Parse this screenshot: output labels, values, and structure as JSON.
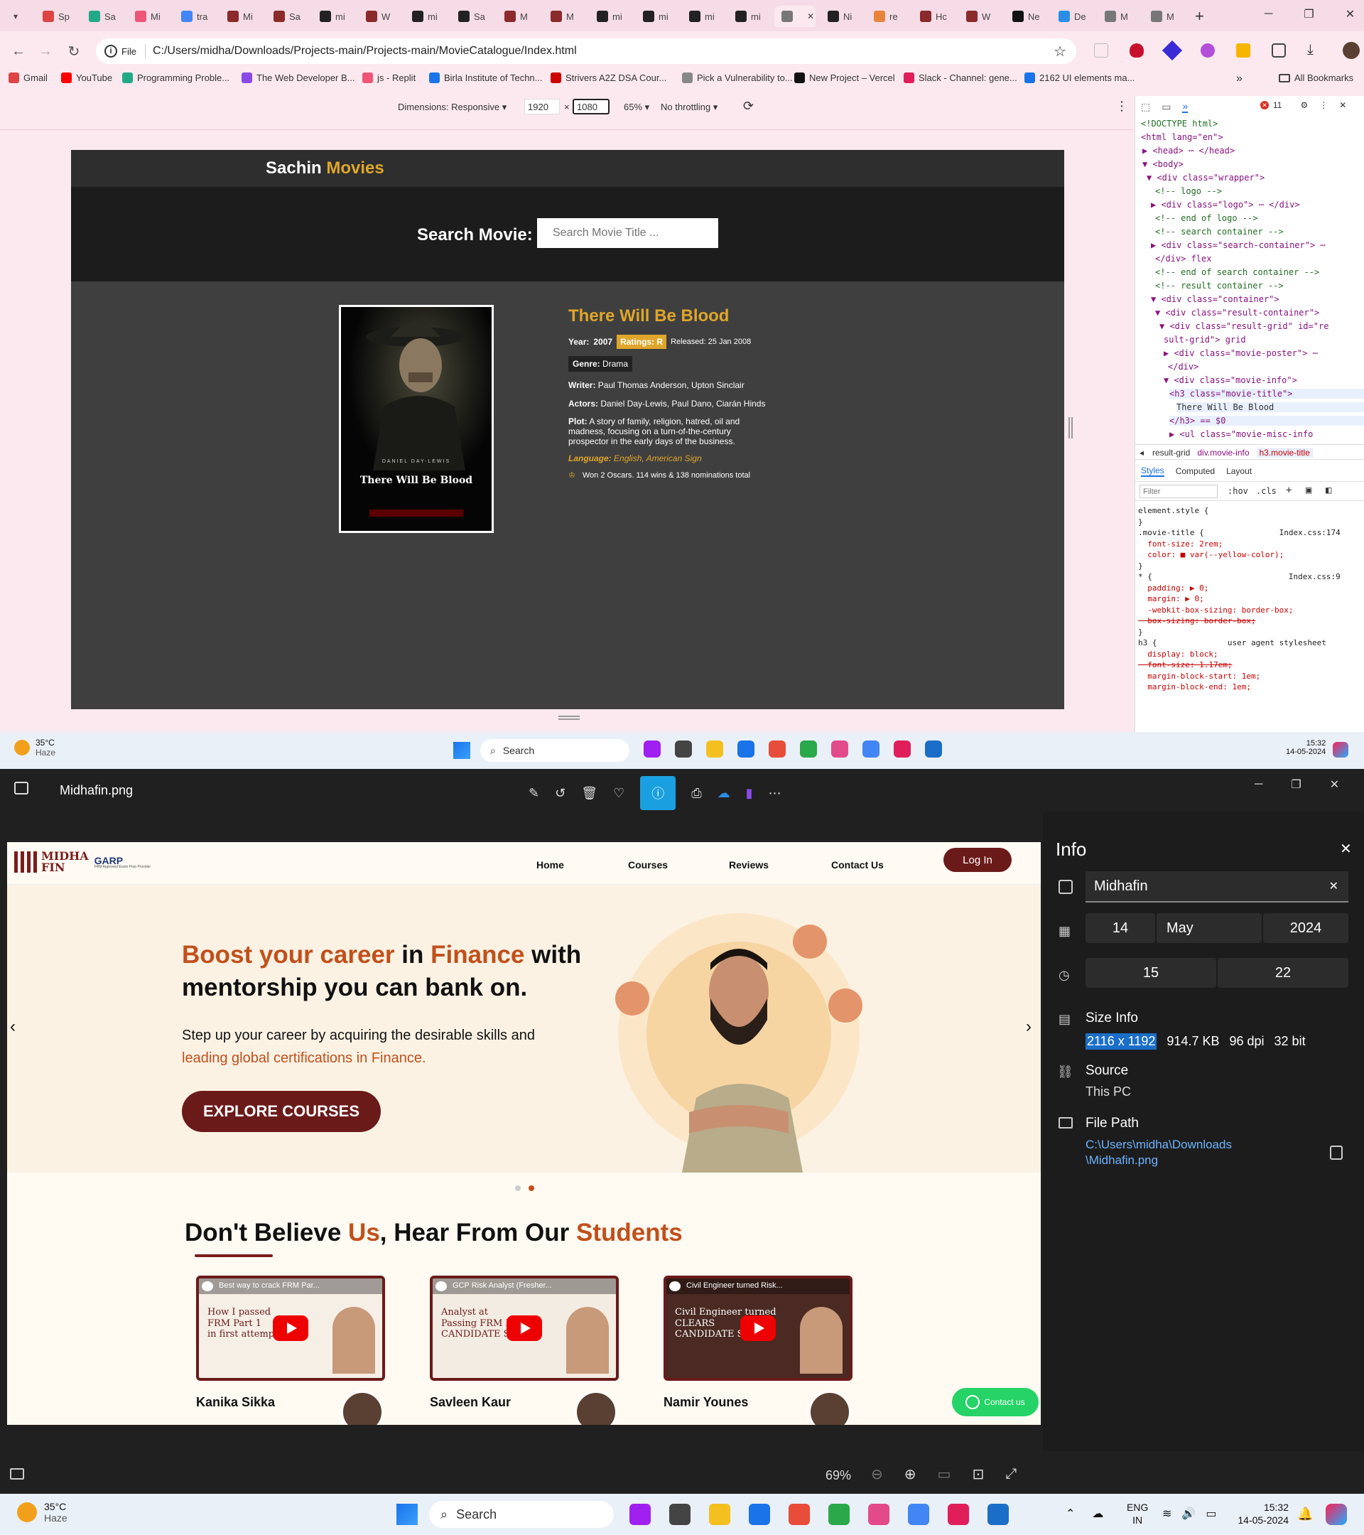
{
  "browser": {
    "tabs": [
      "Sp",
      "Sa",
      "Mi",
      "tra",
      "Mi",
      "Sa",
      "mi",
      "W",
      "mi",
      "Sa",
      "M",
      "M",
      "mi",
      "mi",
      "mi",
      "mi",
      "",
      "Ni",
      "re",
      "Hc",
      "W",
      "Ne",
      "De",
      "M",
      "M"
    ],
    "new_tab": "+",
    "url_scheme": "File",
    "url": "C:/Users/midha/Downloads/Projects-main/Projects-main/MovieCatalogue/Index.html",
    "bookmarks": [
      "Gmail",
      "YouTube",
      "Programming Proble...",
      "The Web Developer B...",
      "js - Replit",
      "Birla Institute of Techn...",
      "Strivers A2Z DSA Cour...",
      "Pick a Vulnerability to...",
      "New Project – Vercel",
      "Slack - Channel: gene...",
      "2162 UI elements ma..."
    ],
    "all_bookmarks": "All Bookmarks",
    "device_toolbar": {
      "dimensions": "Dimensions: Responsive",
      "width": "1920",
      "x": "×",
      "height": "1080",
      "zoom": "65%",
      "throttling": "No throttling"
    }
  },
  "movie_site": {
    "brand_first": "Sachin",
    "brand_second": "Movies",
    "search_label": "Search Movie:",
    "search_placeholder": "Search Movie Title ...",
    "movie": {
      "title": "There Will Be Blood",
      "year_label": "Year:",
      "year": "2007",
      "ratings": "Ratings: R",
      "released": "Released: 25 Jan 2008",
      "genre_label": "Genre:",
      "genre": "Drama",
      "writer_label": "Writer:",
      "writer": "Paul Thomas Anderson, Upton Sinclair",
      "actors_label": "Actors:",
      "actors": "Daniel Day-Lewis, Paul Dano, Ciarán Hinds",
      "plot_label": "Plot:",
      "plot": "A story of family, religion, hatred, oil and madness, focusing on a turn-of-the-century prospector in the early days of the business.",
      "language_label": "Language:",
      "language": "English, American Sign",
      "awards": "Won 2 Oscars. 114 wins & 138 nominations total",
      "poster_actor": "DANIEL DAY-LEWIS",
      "poster_title": "There Will Be Blood"
    }
  },
  "devtools": {
    "errors": "11",
    "dom": [
      {
        "t": "<!DOCTYPE html>",
        "c": "cmt"
      },
      {
        "t": "<html lang=\"en\">",
        "c": "tag"
      },
      {
        "t": "▶ <head> ⋯ </head>",
        "c": "tag"
      },
      {
        "t": "▼ <body>",
        "c": "tag"
      },
      {
        "t": "▼ <div class=\"wrapper\">",
        "c": "tag"
      },
      {
        "t": "<!-- logo -->",
        "c": "cmt"
      },
      {
        "t": "▶ <div class=\"logo\"> ⋯ </div>",
        "c": "tag"
      },
      {
        "t": "<!-- end of logo -->",
        "c": "cmt"
      },
      {
        "t": "<!-- search container -->",
        "c": "cmt"
      },
      {
        "t": "▶ <div class=\"search-container\"> ⋯",
        "c": "tag"
      },
      {
        "t": "</div> flex",
        "c": "tag"
      },
      {
        "t": "<!-- end of search container -->",
        "c": "cmt"
      },
      {
        "t": "<!-- result container -->",
        "c": "cmt"
      },
      {
        "t": "▼ <div class=\"container\">",
        "c": "tag"
      },
      {
        "t": "▼ <div class=\"result-container\">",
        "c": "tag"
      },
      {
        "t": "▼ <div class=\"result-grid\" id=\"re",
        "c": "tag"
      },
      {
        "t": "sult-grid\"> grid",
        "c": "tag"
      },
      {
        "t": "▶ <div class=\"movie-poster\"> ⋯",
        "c": "tag"
      },
      {
        "t": "</div>",
        "c": "tag"
      },
      {
        "t": "▼ <div class=\"movie-info\">",
        "c": "tag"
      },
      {
        "t": "<h3 class=\"movie-title\">",
        "c": "tag"
      },
      {
        "t": "There Will Be Blood",
        "c": "plain"
      },
      {
        "t": "</h3> == $0",
        "c": "tag"
      },
      {
        "t": "▶ <ul class=\"movie-misc-info",
        "c": "tag"
      }
    ],
    "breadcrumbs": [
      "result-grid",
      "div.movie-info",
      "h3.movie-title"
    ],
    "style_tabs": [
      "Styles",
      "Computed",
      "Layout"
    ],
    "filter_placeholder": "Filter",
    "hov": ":hov",
    "cls": ".cls",
    "css": [
      "element.style {",
      "}",
      ".movie-title {                Index.css:174",
      "  font-size: 2rem;",
      "  color: ■ var(--yellow-color);",
      "}",
      "* {                             Index.css:9",
      "  padding: ▶ 0;",
      "  margin: ▶ 0;",
      "  -webkit-box-sizing: border-box;",
      "  box-sizing: border-box;",
      "}",
      "h3 {               user agent stylesheet",
      "  display: block;",
      "  font-size: 1.17em;",
      "  margin-block-start: 1em;",
      "  margin-block-end: 1em;"
    ]
  },
  "taskbar_top": {
    "temp": "35°C",
    "weather": "Haze",
    "search": "Search",
    "time": "15:32",
    "date": "14-05-2024"
  },
  "photos": {
    "filename": "Midhafin.png",
    "zoom": "69%",
    "info": {
      "title": "Info",
      "name": "Midhafin",
      "day": "14",
      "month": "May",
      "year": "2024",
      "hour": "15",
      "minute": "22",
      "size_label": "Size Info",
      "dims": "2116 x 1192",
      "filesize": "914.7 KB",
      "dpi": "96 dpi",
      "bit": "32 bit",
      "source_label": "Source",
      "source": "This PC",
      "path_label": "File Path",
      "path1": "C:\\Users\\midha\\Downloads",
      "path2": "\\Midhafin.png"
    },
    "site": {
      "logo1": "MIDHA",
      "logo2": "FIN",
      "logo3": "GARP",
      "logo_tag": "FRM Approved Exam Prep Provider",
      "nav": [
        "Home",
        "Courses",
        "Reviews",
        "Contact Us"
      ],
      "login": "Log In",
      "hero_h_a": "Boost your career",
      "hero_h_b": " in ",
      "hero_h_c": "Finance",
      "hero_h_d": " with",
      "hero_h_e": "mentorship you can bank on.",
      "hero_p1": "Step up your career by acquiring the desirable skills and",
      "hero_p2": "leading global certifications in Finance.",
      "cta": "EXPLORE COURSES",
      "section_a": "Don't Believe ",
      "section_b": "Us",
      "section_c": ", Hear From Our ",
      "section_d": "Students",
      "videos": [
        {
          "top": "Best way to crack FRM Par...",
          "body1": "How I passed",
          "body2": "FRM Part 1",
          "body3": "in first attempt",
          "name": "Kanika Sikka"
        },
        {
          "top": "GCP Risk Analyst (Fresher...",
          "body1": "Analyst at",
          "body2": "Passing FRM Part 1",
          "body3": "CANDIDATE SPEAKS",
          "name": "Savleen Kaur"
        },
        {
          "top": "Civil Engineer turned Risk...",
          "body1": "Civil Engineer turned",
          "body2": "CLEARS",
          "body3": "CANDIDATE SPEAKS",
          "name": "Namir Younes"
        }
      ],
      "contact": "Contact us"
    }
  },
  "taskbar_bottom": {
    "temp": "35°C",
    "weather": "Haze",
    "search": "Search",
    "lang1": "ENG",
    "lang2": "IN",
    "time": "15:32",
    "date": "14-05-2024"
  }
}
